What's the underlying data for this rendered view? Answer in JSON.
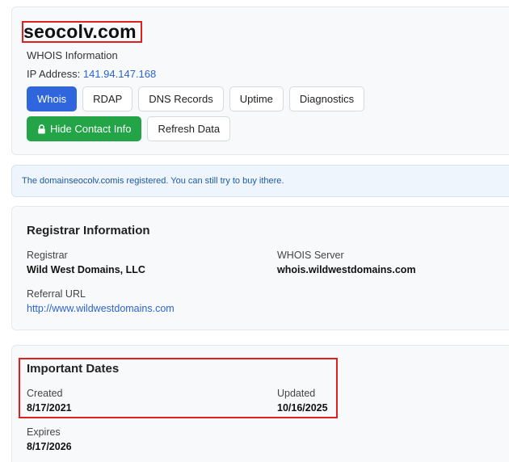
{
  "header": {
    "domain": "seocolv.com",
    "subtitle": "WHOIS Information",
    "ip_label": "IP Address:",
    "ip_value": "141.94.147.168",
    "tabs": [
      {
        "label": "Whois"
      },
      {
        "label": "RDAP"
      },
      {
        "label": "DNS Records"
      },
      {
        "label": "Uptime"
      },
      {
        "label": "Diagnostics"
      },
      {
        "label": "Hide Contact Info",
        "icon": "lock-icon"
      },
      {
        "label": "Refresh Data"
      }
    ]
  },
  "alert": {
    "prefix": "The domain ",
    "domain": "seocolv.com",
    "middle": " is registered. You can still try to buy it ",
    "link": "here",
    "suffix": "."
  },
  "registrar": {
    "title": "Registrar Information",
    "registrar_label": "Registrar",
    "registrar_value": "Wild West Domains, LLC",
    "whois_server_label": "WHOIS Server",
    "whois_server_value": "whois.wildwestdomains.com",
    "referral_label": "Referral URL",
    "referral_value": "http://www.wildwestdomains.com"
  },
  "dates": {
    "title": "Important Dates",
    "created_label": "Created",
    "created_value": "8/17/2021",
    "updated_label": "Updated",
    "updated_value": "10/16/2025",
    "expires_label": "Expires",
    "expires_value": "8/17/2026"
  },
  "colors": {
    "primary": "#2f66dd",
    "success": "#22a447",
    "link": "#2c63d4",
    "annotation": "#e02020"
  }
}
